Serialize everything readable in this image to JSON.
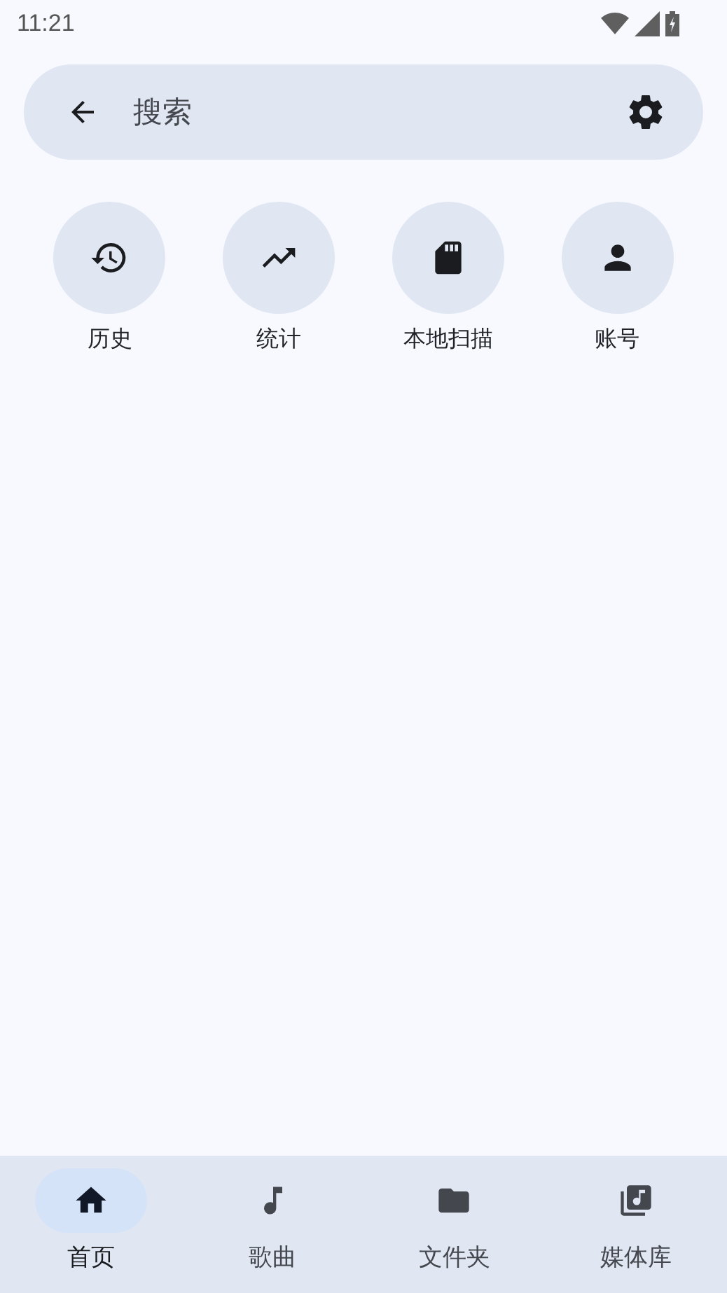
{
  "status_bar": {
    "time": "11:21"
  },
  "search": {
    "placeholder": "搜索"
  },
  "shortcuts": [
    {
      "kind": "history",
      "label": "历史"
    },
    {
      "kind": "trending",
      "label": "统计"
    },
    {
      "kind": "sdcard",
      "label": "本地扫描"
    },
    {
      "kind": "person",
      "label": "账号"
    }
  ],
  "nav": [
    {
      "kind": "home",
      "label": "首页",
      "selected": true
    },
    {
      "kind": "note",
      "label": "歌曲",
      "selected": false
    },
    {
      "kind": "folder",
      "label": "文件夹",
      "selected": false
    },
    {
      "kind": "library",
      "label": "媒体库",
      "selected": false
    }
  ]
}
